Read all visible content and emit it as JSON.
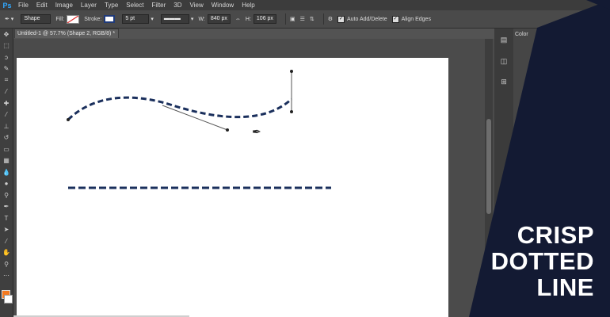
{
  "app": {
    "logo": "Ps"
  },
  "menu": [
    "File",
    "Edit",
    "Image",
    "Layer",
    "Type",
    "Select",
    "Filter",
    "3D",
    "View",
    "Window",
    "Help"
  ],
  "options_bar": {
    "mode": "Shape",
    "fill_label": "Fill:",
    "stroke_label": "Stroke:",
    "stroke_width": "5 pt",
    "w_label": "W:",
    "w_value": "840 px",
    "h_label": "H:",
    "h_value": "106 px",
    "auto_add_delete": "Auto Add/Delete",
    "align_edges": "Align Edges",
    "stroke_color": "#1f3a7a"
  },
  "document_tab": {
    "title": "Untitled-1 @ 57.7% (Shape 2, RGB/8) *"
  },
  "right_panel": {
    "tab": "Color"
  },
  "overlay": {
    "lines": [
      "CRISP",
      "DOTTED",
      "LINE"
    ],
    "bg_color": "#131a33",
    "text_color": "#ffffff"
  },
  "colors": {
    "foreground": "#f47a20",
    "background": "#ffffff",
    "path_color": "#1a2f5c"
  },
  "tools": [
    "move-icon",
    "marquee-icon",
    "lasso-icon",
    "quick-select-icon",
    "crop-icon",
    "eyedropper-icon",
    "healing-icon",
    "brush-icon",
    "stamp-icon",
    "history-brush-icon",
    "eraser-icon",
    "gradient-icon",
    "blur-icon",
    "dodge-icon",
    "pen-icon",
    "type-icon",
    "path-select-icon",
    "shape-icon",
    "hand-icon",
    "zoom-icon"
  ]
}
